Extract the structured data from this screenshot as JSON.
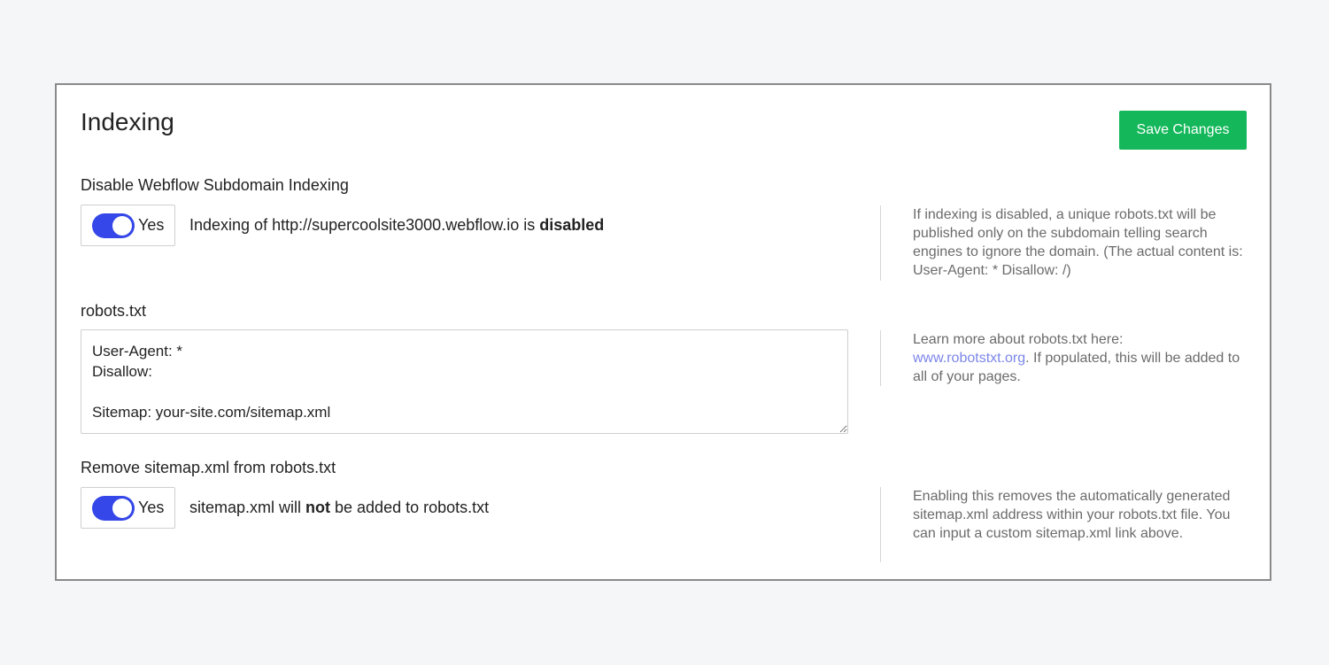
{
  "header": {
    "title": "Indexing",
    "save_label": "Save Changes"
  },
  "subdomain_indexing": {
    "label": "Disable Webflow Subdomain Indexing",
    "toggle_label": "Yes",
    "toggle_on": true,
    "status_prefix": "Indexing of http://supercoolsite3000.webflow.io is ",
    "status_bold": "disabled",
    "help": "If indexing is disabled, a unique robots.txt will be published only on the subdomain telling search engines to ignore the domain. (The actual content is: User-Agent: * Disallow: /)"
  },
  "robots_txt": {
    "label": "robots.txt",
    "value": "User-Agent: *\nDisallow:\n\nSitemap: your-site.com/sitemap.xml",
    "help_prefix": "Learn more about robots.txt here: ",
    "help_link": "www.robotstxt.org",
    "help_suffix": ". If populated, this will be added to all of your pages."
  },
  "remove_sitemap": {
    "label": "Remove sitemap.xml from robots.txt",
    "toggle_label": "Yes",
    "toggle_on": true,
    "status_prefix": "sitemap.xml will ",
    "status_bold": "not",
    "status_suffix": " be added to robots.txt",
    "help": "Enabling this removes the automatically generated sitemap.xml address within your robots.txt file. You can input a custom sitemap.xml link above."
  },
  "colors": {
    "save_button": "#14b85a",
    "toggle_on": "#3547e8",
    "link": "#7b86e8"
  }
}
